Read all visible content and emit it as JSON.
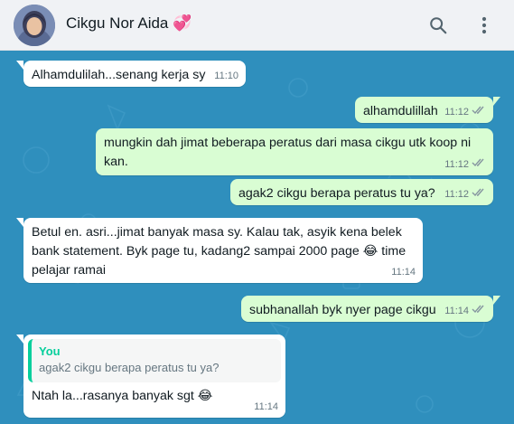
{
  "header": {
    "contact_name": "Cikgu Nor Aida",
    "heart_emoji": "💞",
    "icons": [
      "search-icon",
      "menu-icon"
    ]
  },
  "colors": {
    "chat_bg": "#2f8fbd",
    "incoming": "#ffffff",
    "outgoing": "#d9fdd3",
    "quote_accent": "#06cf9c",
    "tick_gray": "#8696a0"
  },
  "messages": [
    {
      "dir": "in",
      "text": "Alhamdulilah...senang kerja sy",
      "time": "11:10"
    },
    {
      "dir": "out",
      "text": "alhamdulillah",
      "time": "11:12",
      "status": "read-gray"
    },
    {
      "dir": "out",
      "text": "mungkin dah jimat beberapa peratus dari masa cikgu utk koop ni kan.",
      "time": "11:12",
      "status": "read-gray"
    },
    {
      "dir": "out",
      "text": "agak2 cikgu berapa peratus tu ya?",
      "time": "11:12",
      "status": "read-gray"
    },
    {
      "dir": "in",
      "text": "Betul en. asri...jimat banyak masa sy. Kalau tak, asyik kena belek bank statement. Byk page tu, kadang2 sampai 2000 page 😂 time pelajar ramai",
      "time": "11:14"
    },
    {
      "dir": "out",
      "text": "subhanallah byk nyer page cikgu",
      "time": "11:14",
      "status": "read-gray"
    },
    {
      "dir": "in",
      "quote_author": "You",
      "quote_text": "agak2 cikgu berapa peratus tu ya?",
      "text": "Ntah la...rasanya banyak sgt 😂",
      "time": "11:14"
    }
  ]
}
